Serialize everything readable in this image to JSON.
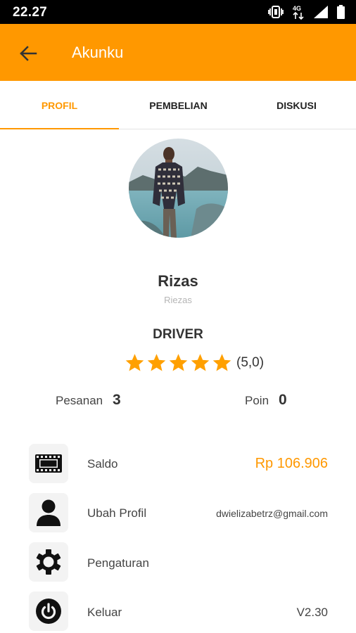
{
  "status_bar": {
    "time": "22.27",
    "network": "4G",
    "icons": [
      "vibrate-icon",
      "mobile-data-icon",
      "signal-icon",
      "battery-icon"
    ]
  },
  "app_bar": {
    "title": "Akunku",
    "back_icon": "back-arrow-icon",
    "color": "#FF9800"
  },
  "tabs": [
    {
      "label": "PROFIL",
      "active": true
    },
    {
      "label": "PEMBELIAN",
      "active": false
    },
    {
      "label": "DISKUSI",
      "active": false
    }
  ],
  "profile": {
    "name": "Rizas",
    "username": "Riezas",
    "role": "DRIVER",
    "rating": 5,
    "rating_max": 5,
    "rating_text": "(5,0)"
  },
  "stats": {
    "orders_label": "Pesanan",
    "orders_value": "3",
    "points_label": "Poin",
    "points_value": "0"
  },
  "menu": [
    {
      "icon": "film-strip-icon",
      "label": "Saldo",
      "value": "Rp 106.906",
      "value_color": "#FF9800"
    },
    {
      "icon": "person-icon",
      "label": "Ubah Profil",
      "value": "dwielizabetrz@gmail.com"
    },
    {
      "icon": "gear-icon",
      "label": "Pengaturan",
      "value": ""
    },
    {
      "icon": "power-icon",
      "label": "Keluar",
      "value": "V2.30"
    }
  ],
  "colors": {
    "accent": "#FF9800",
    "star": "#FFA000",
    "muted_text": "#b5b5b5"
  }
}
